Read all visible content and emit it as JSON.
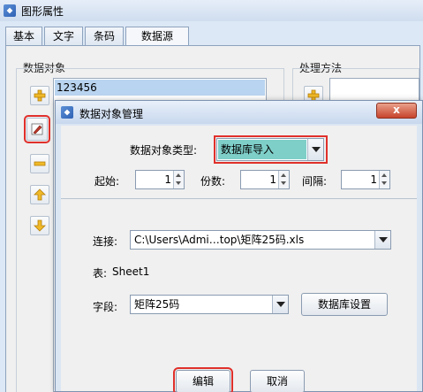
{
  "outer_window": {
    "title": "图形属性",
    "tabs": [
      {
        "label": "基本"
      },
      {
        "label": "文字"
      },
      {
        "label": "条码"
      },
      {
        "label": "数据源"
      }
    ],
    "active_tab": "数据源",
    "data_objects_label": "数据对象",
    "data_object_items": [
      "123456"
    ],
    "processing_label": "处理方法"
  },
  "dialog": {
    "title": "数据对象管理",
    "close_label": "x",
    "type_label": "数据对象类型:",
    "type_value": "数据库导入",
    "start_label": "起始:",
    "start_value": "1",
    "copies_label": "份数:",
    "copies_value": "1",
    "interval_label": "间隔:",
    "interval_value": "1",
    "connection_label": "连接:",
    "connection_value": "C:\\Users\\Admi…top\\矩阵25码.xls",
    "table_label": "表:",
    "table_value": "Sheet1",
    "field_label": "字段:",
    "field_value": "矩阵25码",
    "db_settings_label": "数据库设置",
    "edit_label": "编辑",
    "cancel_label": "取消"
  },
  "colors": {
    "highlight_red": "#e0302b",
    "selection_teal": "#7fcfc9",
    "list_selection": "#b9d4f0"
  }
}
